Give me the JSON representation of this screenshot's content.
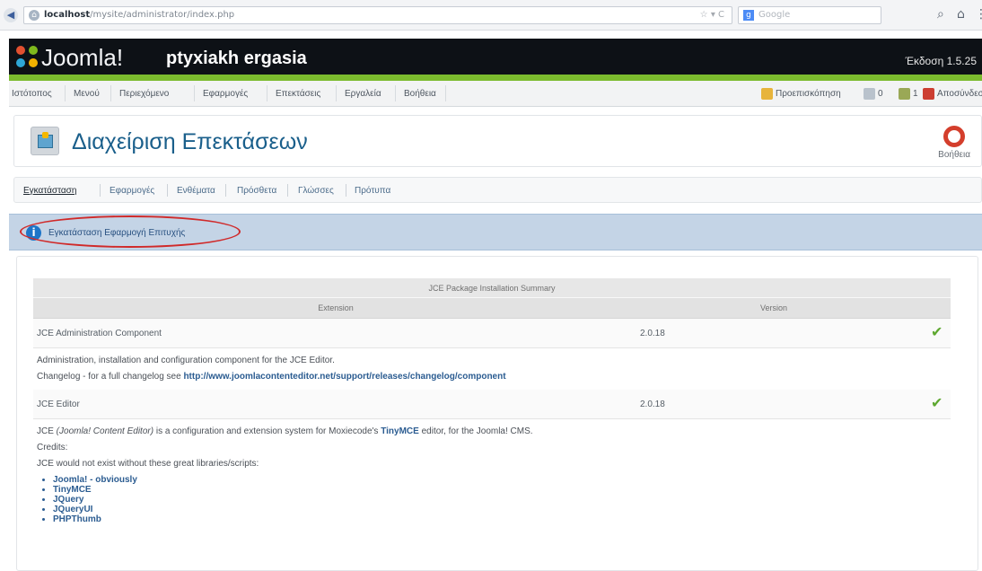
{
  "browser": {
    "back_icon": "back-arrow-icon",
    "url_prefix": "localhost",
    "url_rest": "/mysite/administrator/index.php",
    "url_tools": "☆ ▾ C",
    "search_engine": "Google",
    "search_placeholder": "Google"
  },
  "header": {
    "logo_text": "Joomla!",
    "site_name": "ptyxiakh ergasia",
    "version": "Έκδοση 1.5.25"
  },
  "menu": {
    "items": [
      "Ιστότοπος",
      "Μενού",
      "Περιεχόμενο",
      "Εφαρμογές",
      "Επεκτάσεις",
      "Εργαλεία",
      "Βοήθεια"
    ],
    "preview": "Προεπισκόπηση",
    "messages_count": "0",
    "users_count": "1",
    "logout": "Αποσύνδεση"
  },
  "page": {
    "title": "Διαχείριση Επεκτάσεων",
    "help": "Βοήθεια"
  },
  "tabs": [
    "Εγκατάσταση",
    "Εφαρμογές",
    "Ενθέματα",
    "Πρόσθετα",
    "Γλώσσες",
    "Πρότυπα"
  ],
  "message": {
    "text": "Εγκατάσταση Εφαρμογή Επιτυχής"
  },
  "summary": {
    "title": "JCE Package Installation Summary",
    "col_extension": "Extension",
    "col_version": "Version",
    "rows": [
      {
        "name": "JCE Administration Component",
        "version": "2.0.18"
      },
      {
        "name": "JCE Editor",
        "version": "2.0.18"
      }
    ],
    "component_description": "Administration, installation and configuration component for the JCE Editor.",
    "changelog_label": "Changelog - for a full changelog see ",
    "changelog_link": "http://www.joomlacontenteditor.net/support/releases/changelog/component",
    "editor_description_prefix": "JCE ",
    "editor_description_italic": "(Joomla! Content Editor)",
    "editor_description_mid": " is a configuration and extension system for Moxiecode's ",
    "editor_description_link": "TinyMCE",
    "editor_description_suffix": " editor, for the Joomla! CMS.",
    "credits_label": "Credits:",
    "libraries_intro": "JCE would not exist without these great libraries/scripts:",
    "libraries": [
      "Joomla! - obviously",
      "TinyMCE",
      "JQuery",
      "JQueryUI",
      "PHPThumb"
    ]
  }
}
